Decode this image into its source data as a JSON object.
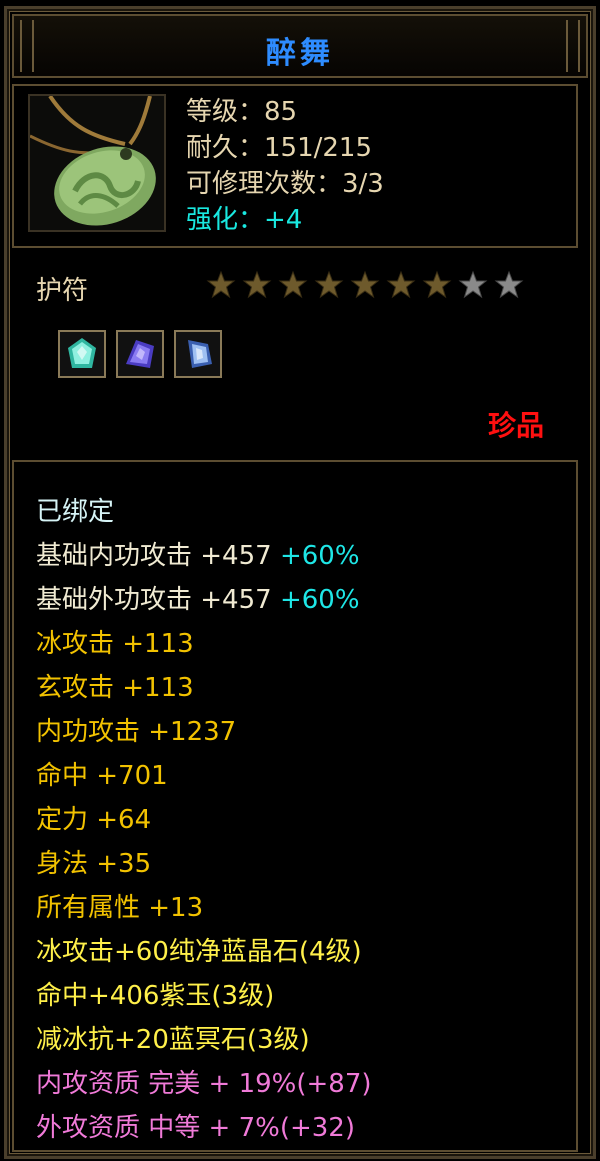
{
  "item": {
    "name": "醉舞",
    "icon": "jade-amulet-icon",
    "level_label": "等级：85",
    "durability_label": "耐久：151/215",
    "repair_label": "可修理次数：3/3",
    "enhance_label": "强化：+4",
    "type": "护符",
    "rarity": "珍品",
    "stars_filled": 7,
    "stars_total": 9,
    "gems": [
      "green-crystal-gem-icon",
      "purple-crystal-gem-icon",
      "blue-crystal-gem-icon"
    ]
  },
  "attributes": {
    "bound": "已绑定",
    "base_inner": {
      "label": "基础内功攻击 +457 ",
      "bonus": "+60%"
    },
    "base_outer": {
      "label": "基础外功攻击 +457 ",
      "bonus": "+60%"
    },
    "ice_attack": "冰攻击 +113",
    "xuan_attack": "玄攻击 +113",
    "inner_attack": "内功攻击 +1237",
    "hit": "命中 +701",
    "focus": "定力 +64",
    "agility": "身法 +35",
    "all_attributes": "所有属性 +13",
    "gem1": "冰攻击+60纯净蓝晶石(4级)",
    "gem2": "命中+406紫玉(3级)",
    "gem3": "减冰抗+20蓝冥石(3级)",
    "inner_quality": "内攻资质 完美 + 19%(+87)",
    "outer_quality": "外攻资质 中等 + 7%(+32)"
  },
  "colors": {
    "title": "#2e8cff",
    "enhance": "#19e8e0",
    "rarity": "#ff1010",
    "gold_stat": "#f2c200",
    "gem_stat": "#fff04a",
    "quality": "#f07ad8"
  }
}
